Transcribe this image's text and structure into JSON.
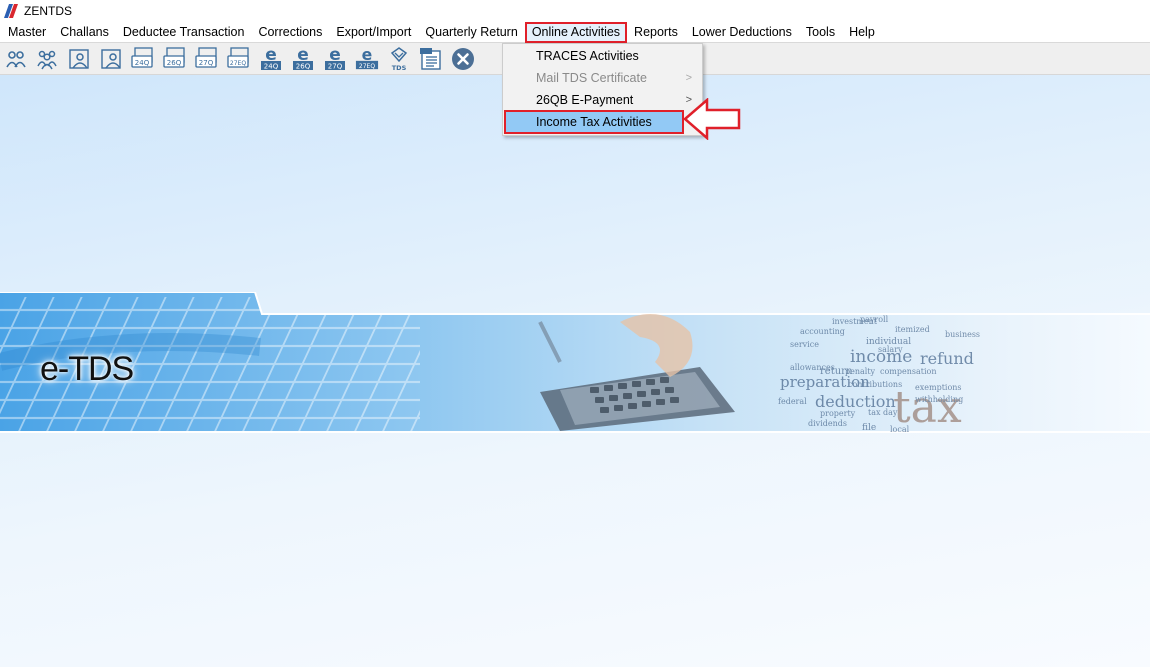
{
  "window": {
    "title": "ZENTDS"
  },
  "menubar": {
    "items": [
      "Master",
      "Challans",
      "Deductee Transaction",
      "Corrections",
      "Export/Import",
      "Quarterly Return",
      "Online Activities",
      "Reports",
      "Lower Deductions",
      "Tools",
      "Help"
    ],
    "open_item": "Online Activities"
  },
  "toolbar": {
    "icons": [
      "deductor-icon",
      "deductees-icon",
      "deductor-user-icon",
      "deductee-user-icon",
      "form-24q-icon",
      "form-26q-icon",
      "form-27q-icon",
      "form-27eq-icon",
      "e-24q-icon",
      "e-26q-icon",
      "e-27q-icon",
      "e-27eq-icon",
      "tds-icon",
      "pdf-export-icon",
      "exit-icon"
    ],
    "form_labels": [
      "24Q",
      "26Q",
      "27Q",
      "27EQ"
    ],
    "e_labels": [
      "24Q",
      "26Q",
      "27Q",
      "27EQ"
    ],
    "tds_label": "TDS",
    "e_letter": "e"
  },
  "dropdown": {
    "items": [
      {
        "label": "TRACES Activities",
        "disabled": false,
        "submenu": false
      },
      {
        "label": "Mail TDS Certificate",
        "disabled": true,
        "submenu": true
      },
      {
        "label": "26QB E-Payment",
        "disabled": false,
        "submenu": true
      },
      {
        "label": "Income Tax Activities",
        "disabled": false,
        "submenu": false,
        "highlighted": true
      }
    ],
    "submenu_glyph": ">"
  },
  "banner": {
    "label": "e-TDS",
    "word_cloud": [
      "payroll",
      "investment",
      "accounting",
      "itemized",
      "income",
      "refund",
      "preparation",
      "deduction",
      "tax",
      "return",
      "penalty",
      "compensation",
      "dividends",
      "file",
      "local",
      "property",
      "tax day",
      "service",
      "salary",
      "exemptions",
      "federal",
      "withholding",
      "allowances",
      "contributions",
      "individual",
      "business"
    ]
  },
  "colors": {
    "highlight_border": "#e0202a",
    "selected_item_bg": "#92c9f5",
    "desktop_bg": "#e2f0fc"
  }
}
